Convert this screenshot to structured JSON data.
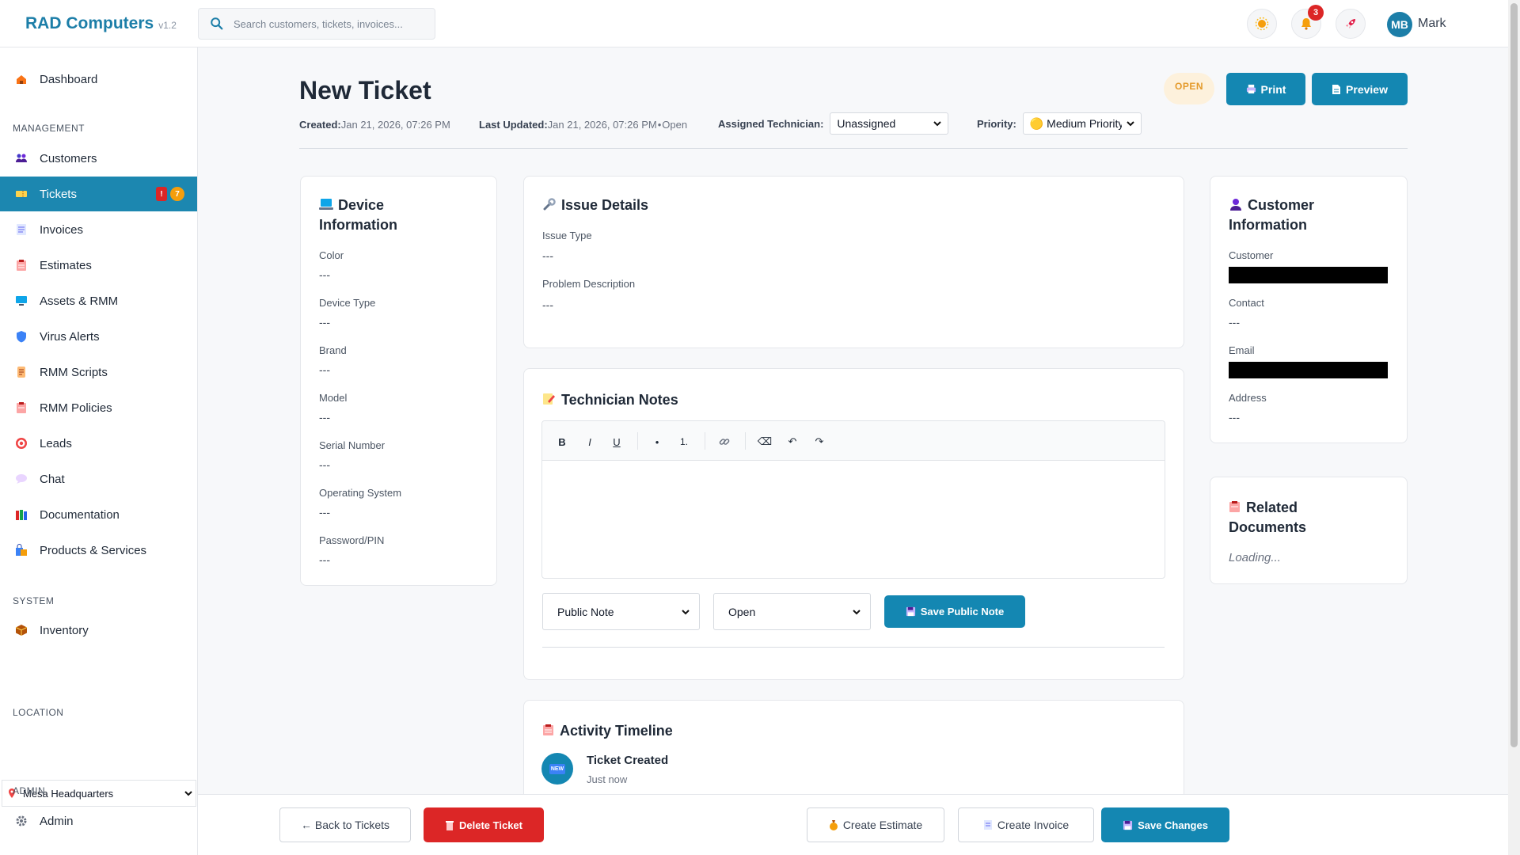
{
  "app": {
    "name": "RAD Computers",
    "version": "v1.2"
  },
  "search": {
    "placeholder": "Search customers, tickets, invoices..."
  },
  "topbar": {
    "notification_count": "3",
    "user_initials": "MB",
    "user_name": "Mark"
  },
  "sidebar": {
    "dashboard": "Dashboard",
    "section_management": "MANAGEMENT",
    "items": [
      {
        "label": "Customers",
        "icon": "users-icon"
      },
      {
        "label": "Tickets",
        "icon": "ticket-icon",
        "active": true,
        "badge_alert": "!",
        "badge_count": "7"
      },
      {
        "label": "Invoices",
        "icon": "invoice-icon"
      },
      {
        "label": "Estimates",
        "icon": "clipboard-icon"
      },
      {
        "label": "Assets & RMM",
        "icon": "monitor-icon"
      },
      {
        "label": "Virus Alerts",
        "icon": "shield-icon"
      },
      {
        "label": "RMM Scripts",
        "icon": "scroll-icon"
      },
      {
        "label": "RMM Policies",
        "icon": "clipboard-icon"
      },
      {
        "label": "Leads",
        "icon": "target-icon"
      },
      {
        "label": "Chat",
        "icon": "chat-icon"
      },
      {
        "label": "Documentation",
        "icon": "books-icon"
      },
      {
        "label": "Products & Services",
        "icon": "shopping-icon"
      }
    ],
    "section_system": "SYSTEM",
    "inventory": "Inventory",
    "section_location": "LOCATION",
    "location": "Mesa Headquarters",
    "section_admin": "ADMIN",
    "admin": "Admin"
  },
  "ticket": {
    "title": "New Ticket",
    "status": "OPEN",
    "print_label": "Print",
    "preview_label": "Preview",
    "created_label": "Created:",
    "created_value": "Jan 21, 2026, 07:26 PM",
    "updated_label": "Last Updated:",
    "updated_value": "Jan 21, 2026, 07:26 PM",
    "updated_status": "Open",
    "tech_label": "Assigned Technician:",
    "tech_value": "Unassigned",
    "priority_label": "Priority:",
    "priority_value": "🟡 Medium Priority"
  },
  "device": {
    "title_line1": "Device",
    "title_line2": "Information",
    "fields": [
      {
        "label": "Color",
        "value": "---"
      },
      {
        "label": "Device Type",
        "value": "---"
      },
      {
        "label": "Brand",
        "value": "---"
      },
      {
        "label": "Model",
        "value": "---"
      },
      {
        "label": "Serial Number",
        "value": "---"
      },
      {
        "label": "Operating System",
        "value": "---"
      },
      {
        "label": "Password/PIN",
        "value": "---"
      }
    ]
  },
  "issue": {
    "title": "Issue Details",
    "type_label": "Issue Type",
    "type_value": "---",
    "desc_label": "Problem Description",
    "desc_value": "---"
  },
  "notes": {
    "title": "Technician Notes",
    "toolbar": {
      "bold": "B",
      "italic": "I",
      "underline": "U",
      "bullet": "•",
      "numbered": "1.",
      "link": "🔗",
      "clear": "⌫",
      "undo": "↶",
      "redo": "↷"
    },
    "note_type": "Public Note",
    "note_status": "Open",
    "save_label": "Save Public Note"
  },
  "activity": {
    "title": "Activity Timeline",
    "event_badge": "NEW",
    "event_title": "Ticket Created",
    "event_time": "Just now"
  },
  "customer": {
    "title_line1": "Customer",
    "title_line2": "Information",
    "customer_label": "Customer",
    "contact_label": "Contact",
    "contact_value": "---",
    "email_label": "Email",
    "address_label": "Address",
    "address_value": "---"
  },
  "related": {
    "title_line1": "Related",
    "title_line2": "Documents",
    "loading": "Loading..."
  },
  "footer": {
    "back": "← Back to Tickets",
    "delete": "Delete Ticket",
    "estimate": "Create Estimate",
    "invoice": "Create Invoice",
    "save": "Save Changes"
  },
  "colors": {
    "accent": "#1487b2",
    "danger": "#dc2626",
    "status_open": "#e49a2b"
  }
}
